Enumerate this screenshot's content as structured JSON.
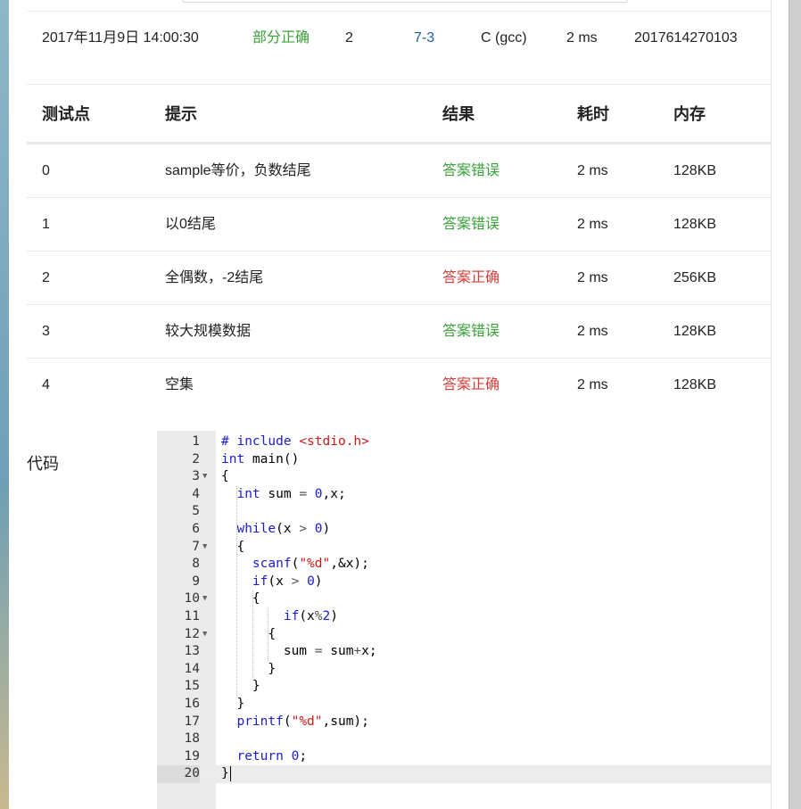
{
  "submission": {
    "time": "2017年11月9日 14:00:30",
    "status": "部分正确",
    "score": "2",
    "problem": "7-3",
    "compiler": "C (gcc)",
    "duration": "2 ms",
    "user": "2017614270103"
  },
  "tests": {
    "headers": [
      "测试点",
      "提示",
      "结果",
      "耗时",
      "内存"
    ],
    "rows": [
      {
        "id": "0",
        "hint": "sample等价，负数结尾",
        "result": "答案错误",
        "result_color": "#3aa13a",
        "time": "2 ms",
        "memory": "128KB"
      },
      {
        "id": "1",
        "hint": "以0结尾",
        "result": "答案错误",
        "result_color": "#3aa13a",
        "time": "2 ms",
        "memory": "128KB"
      },
      {
        "id": "2",
        "hint": "全偶数，-2结尾",
        "result": "答案正确",
        "result_color": "#d43f3a",
        "time": "2 ms",
        "memory": "256KB"
      },
      {
        "id": "3",
        "hint": "较大规模数据",
        "result": "答案错误",
        "result_color": "#3aa13a",
        "time": "2 ms",
        "memory": "128KB"
      },
      {
        "id": "4",
        "hint": "空集",
        "result": "答案正确",
        "result_color": "#d43f3a",
        "time": "2 ms",
        "memory": "128KB"
      }
    ]
  },
  "code_section": {
    "label": "代码",
    "lines": [
      "# include <stdio.h>",
      "int main()",
      "{",
      "  int sum = 0,x;",
      "",
      "  while(x > 0)",
      "  {",
      "    scanf(\"%d\",&x);",
      "    if(x > 0)",
      "    {",
      "        if(x%2)",
      "      {",
      "        sum = sum+x;",
      "      }",
      "    }",
      "  }",
      "  printf(\"%d\",sum);",
      "",
      "  return 0;",
      "}"
    ],
    "fold_lines": [
      3,
      7,
      10,
      12
    ],
    "active_line": 20
  }
}
